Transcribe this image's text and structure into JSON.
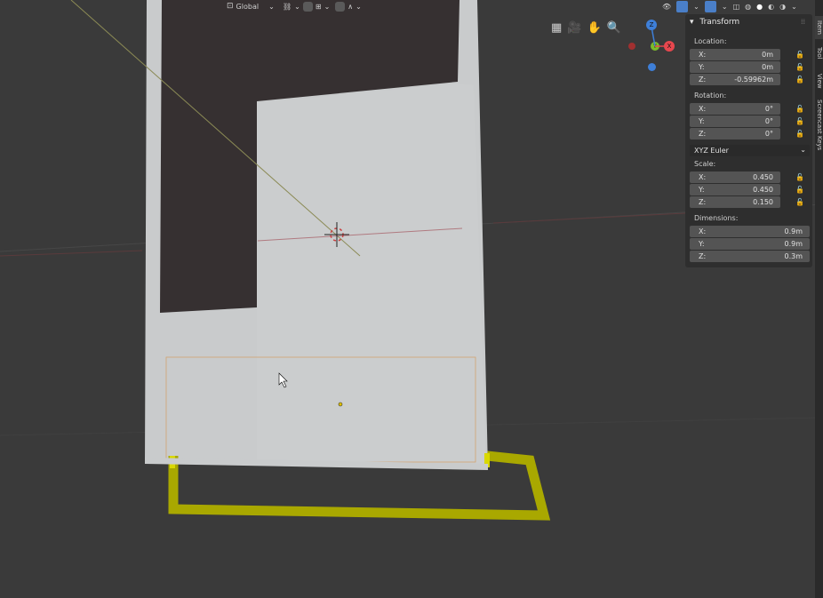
{
  "header": {
    "orientation": "Global"
  },
  "panel": {
    "title": "Transform",
    "location": {
      "label": "Location:",
      "fields": [
        {
          "axis": "X:",
          "value": "0m"
        },
        {
          "axis": "Y:",
          "value": "0m"
        },
        {
          "axis": "Z:",
          "value": "-0.59962m"
        }
      ]
    },
    "rotation": {
      "label": "Rotation:",
      "fields": [
        {
          "axis": "X:",
          "value": "0°"
        },
        {
          "axis": "Y:",
          "value": "0°"
        },
        {
          "axis": "Z:",
          "value": "0°"
        }
      ]
    },
    "rotation_mode": "XYZ Euler",
    "scale": {
      "label": "Scale:",
      "fields": [
        {
          "axis": "X:",
          "value": "0.450"
        },
        {
          "axis": "Y:",
          "value": "0.450"
        },
        {
          "axis": "Z:",
          "value": "0.150"
        }
      ]
    },
    "dimensions": {
      "label": "Dimensions:",
      "fields": [
        {
          "axis": "X:",
          "value": "0.9m"
        },
        {
          "axis": "Y:",
          "value": "0.9m"
        },
        {
          "axis": "Z:",
          "value": "0.3m"
        }
      ]
    }
  },
  "side_tabs": [
    "Item",
    "Tool",
    "View",
    "Screencast Keys"
  ],
  "gizmo": {
    "x": "X",
    "y": "Y",
    "z": "Z"
  },
  "colors": {
    "axis_x": "#e8474e",
    "axis_y": "#7cbb2a",
    "axis_z": "#3e7fd8",
    "active_blue": "#4a7fc8",
    "object_select": "#d49a58",
    "edge_select": "#c8c810",
    "plane": "#c9cbcc"
  }
}
